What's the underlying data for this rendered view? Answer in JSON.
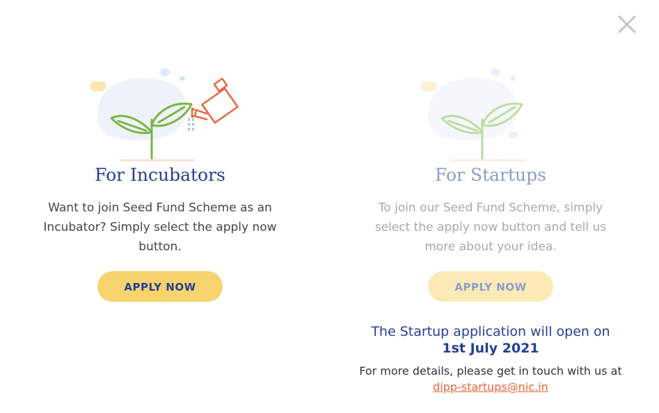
{
  "close": {
    "icon": "close-icon"
  },
  "incubators": {
    "title": "For Incubators",
    "description": "Want to join Seed Fund Scheme as an Incubator? Simply select the apply now button.",
    "button_label": "APPLY NOW",
    "illustration": "plant-watering-can-icon"
  },
  "startups": {
    "title": "For Startups",
    "description": "To join our Seed Fund Scheme, simply select the apply now button and tell us more about your idea.",
    "button_label": "APPLY NOW",
    "illustration": "plant-icon",
    "state": "disabled"
  },
  "notice": {
    "line1": "The Startup application will open on",
    "date": "1st July 2021",
    "contact": "For more details, please get in touch with us at",
    "email": "dipp-startups@nic.in"
  },
  "colors": {
    "title": "#233f94",
    "button": "#f6d36c",
    "button_disabled": "#fbeab6",
    "link": "#e8663d",
    "leaf": "#7cb342",
    "can": "#e8663d"
  }
}
